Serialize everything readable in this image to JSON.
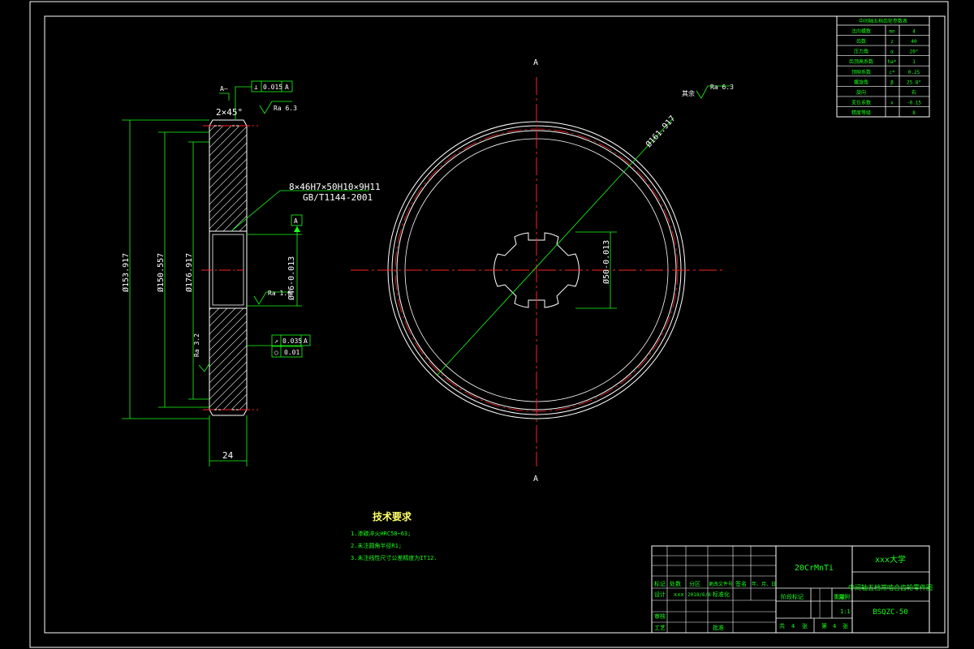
{
  "drawing": {
    "view_mark_top": "A",
    "view_mark_bottom": "A",
    "datum_box": "A",
    "section_symbol": "A—",
    "chamfer": "2×45°",
    "face_width": "24",
    "dim_outer": "Ø153.917",
    "dim_mid": "Ø150.557",
    "dim_pitch": "Ø176.917",
    "dim_bore": "Ø46-0.013",
    "dim_spline": "Ø50-0.013",
    "dim_face_diameter": "Ø161.917",
    "spline_spec_line1": "8×46H7×50H10×9H11",
    "spline_spec_line2": "GB/T1144-2001",
    "roughness_top": "Ra 6.3",
    "roughness_bore": "Ra 1.6",
    "roughness_tooth": "Ra 3.2",
    "roughness_rest_label": "其余",
    "roughness_rest": "Ra 6.3",
    "tol_top": {
      "sym": "⊥",
      "value": "0.015",
      "datum": "A"
    },
    "tol_mid1": {
      "sym": "↗",
      "value": "0.035",
      "datum": "A"
    },
    "tol_mid2": {
      "sym": "○",
      "value": "0.01",
      "datum": ""
    }
  },
  "param_table": {
    "title": "中间轴五档齿轮参数表",
    "rows": [
      {
        "name": "法向模数",
        "sym": "mn",
        "val": "4"
      },
      {
        "name": "齿数",
        "sym": "z",
        "val": "40"
      },
      {
        "name": "压力角",
        "sym": "α",
        "val": "20°"
      },
      {
        "name": "齿顶高系数",
        "sym": "ha*",
        "val": "1"
      },
      {
        "name": "顶隙系数",
        "sym": "c*",
        "val": "0.25"
      },
      {
        "name": "螺旋角",
        "sym": "β",
        "val": "25.8°"
      },
      {
        "name": "旋向",
        "sym": "",
        "val": "右"
      },
      {
        "name": "变位系数",
        "sym": "x",
        "val": "-0.15"
      },
      {
        "name": "精度等级",
        "sym": "",
        "val": "8"
      }
    ]
  },
  "tech_requirements": {
    "title": "技术要求",
    "items": [
      "1.渗碳淬火HRC58~63;",
      "2.未注圆角半径R1;",
      "3.未注线性尺寸公差精度为IT12."
    ]
  },
  "title_block": {
    "material": "20CrMnTi",
    "school": "xxx大学",
    "part_name": "中间轴五档常啮合齿轮零件图",
    "drawing_no": "BSQZC-50",
    "scale_label": "比例",
    "scale": "1:1",
    "weight_label": "重量",
    "stage_label": "阶段标记",
    "sheets_total_label": "共",
    "sheets_total": "4",
    "sheets_unit1": "张",
    "sheet_label": "第",
    "sheet_no": "4",
    "sheets_unit2": "张",
    "h_mark": "标记",
    "h_count": "处数",
    "h_zone": "分区",
    "h_doc": "更改文件号",
    "h_sign": "签名",
    "h_date": "年、月、日",
    "designer_label": "设计",
    "designer": "xxx",
    "design_date": "2018/6/8",
    "std_label": "标准化",
    "review_label": "审核",
    "craft_label": "工艺",
    "approve_label": "批准"
  }
}
